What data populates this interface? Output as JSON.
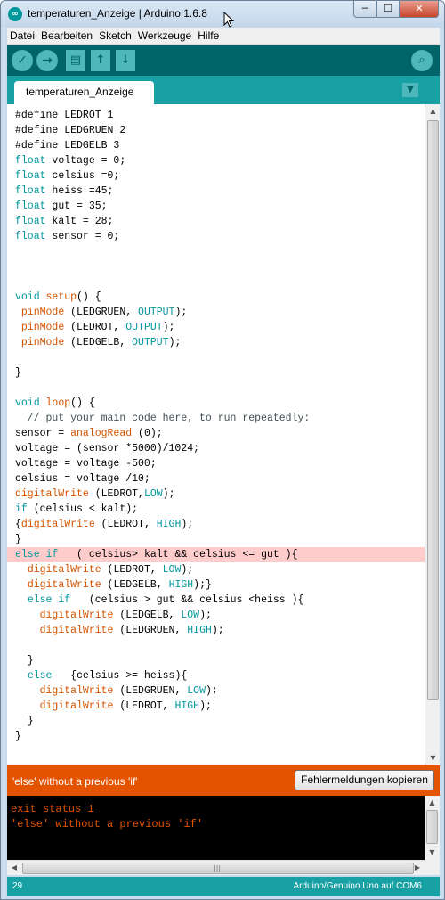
{
  "window": {
    "title": "temperaturen_Anzeige | Arduino 1.6.8",
    "app_icon": "arduino-logo-icon",
    "buttons": {
      "minimize": "─",
      "maximize": "☐",
      "close": "✕"
    }
  },
  "menu": {
    "items": [
      "Datei",
      "Bearbeiten",
      "Sketch",
      "Werkzeuge",
      "Hilfe"
    ]
  },
  "toolbar": {
    "verify_icon": "✓",
    "upload_icon": "→",
    "new_icon": "▤",
    "open_icon": "↑",
    "save_icon": "↓",
    "serial_monitor_icon": "⌕"
  },
  "tabs": {
    "active": "temperaturen_Anzeige",
    "menu_icon": "▼"
  },
  "editor": {
    "lines": [
      [
        {
          "t": "#define LEDROT 1",
          "c": ""
        }
      ],
      [
        {
          "t": "#define LEDGRUEN 2",
          "c": ""
        }
      ],
      [
        {
          "t": "#define LEDGELB 3",
          "c": ""
        }
      ],
      [
        {
          "t": "float",
          "c": "kw"
        },
        {
          "t": " voltage = 0;",
          "c": ""
        }
      ],
      [
        {
          "t": "float",
          "c": "kw"
        },
        {
          "t": " celsius =0;",
          "c": ""
        }
      ],
      [
        {
          "t": "float",
          "c": "kw"
        },
        {
          "t": " heiss =45;",
          "c": ""
        }
      ],
      [
        {
          "t": "float",
          "c": "kw"
        },
        {
          "t": " gut = 35;",
          "c": ""
        }
      ],
      [
        {
          "t": "float",
          "c": "kw"
        },
        {
          "t": " kalt = 28;",
          "c": ""
        }
      ],
      [
        {
          "t": "float",
          "c": "kw"
        },
        {
          "t": " sensor = 0;",
          "c": ""
        }
      ],
      [],
      [],
      [],
      [
        {
          "t": "void",
          "c": "kw"
        },
        {
          "t": " ",
          "c": ""
        },
        {
          "t": "setup",
          "c": "fn"
        },
        {
          "t": "() {",
          "c": ""
        }
      ],
      [
        {
          "t": " ",
          "c": ""
        },
        {
          "t": "pinMode",
          "c": "fn"
        },
        {
          "t": " (LEDGRUEN, ",
          "c": ""
        },
        {
          "t": "OUTPUT",
          "c": "ct"
        },
        {
          "t": ");",
          "c": ""
        }
      ],
      [
        {
          "t": " ",
          "c": ""
        },
        {
          "t": "pinMode",
          "c": "fn"
        },
        {
          "t": " (LEDROT, ",
          "c": ""
        },
        {
          "t": "OUTPUT",
          "c": "ct"
        },
        {
          "t": ");",
          "c": ""
        }
      ],
      [
        {
          "t": " ",
          "c": ""
        },
        {
          "t": "pinMode",
          "c": "fn"
        },
        {
          "t": " (LEDGELB, ",
          "c": ""
        },
        {
          "t": "OUTPUT",
          "c": "ct"
        },
        {
          "t": ");",
          "c": ""
        }
      ],
      [],
      [
        {
          "t": "}",
          "c": ""
        }
      ],
      [],
      [
        {
          "t": "void",
          "c": "kw"
        },
        {
          "t": " ",
          "c": ""
        },
        {
          "t": "loop",
          "c": "fn"
        },
        {
          "t": "() {",
          "c": ""
        }
      ],
      [
        {
          "t": "  // put your main code here, to run repeatedly:",
          "c": "cm"
        }
      ],
      [
        {
          "t": "sensor = ",
          "c": ""
        },
        {
          "t": "analogRead",
          "c": "fn"
        },
        {
          "t": " (0);",
          "c": ""
        }
      ],
      [
        {
          "t": "voltage = (sensor *5000)/1024;",
          "c": ""
        }
      ],
      [
        {
          "t": "voltage = voltage -500;",
          "c": ""
        }
      ],
      [
        {
          "t": "celsius = voltage /10;",
          "c": ""
        }
      ],
      [
        {
          "t": "digitalWrite",
          "c": "fn"
        },
        {
          "t": " (LEDROT,",
          "c": ""
        },
        {
          "t": "LOW",
          "c": "ct"
        },
        {
          "t": ");",
          "c": ""
        }
      ],
      [
        {
          "t": "if",
          "c": "kw"
        },
        {
          "t": " (celsius < kalt);",
          "c": ""
        }
      ],
      [
        {
          "t": "{",
          "c": ""
        },
        {
          "t": "digitalWrite",
          "c": "fn"
        },
        {
          "t": " (LEDROT, ",
          "c": ""
        },
        {
          "t": "HIGH",
          "c": "ct"
        },
        {
          "t": ");",
          "c": ""
        }
      ],
      [
        {
          "t": "}",
          "c": ""
        }
      ],
      [
        {
          "t": "else",
          "c": "kw"
        },
        {
          "t": " ",
          "c": ""
        },
        {
          "t": "if",
          "c": "kw"
        },
        {
          "t": "   ( celsius> kalt && celsius <= gut ){",
          "c": ""
        }
      ],
      [
        {
          "t": "  ",
          "c": ""
        },
        {
          "t": "digitalWrite",
          "c": "fn"
        },
        {
          "t": " (LEDROT, ",
          "c": ""
        },
        {
          "t": "LOW",
          "c": "ct"
        },
        {
          "t": ");",
          "c": ""
        }
      ],
      [
        {
          "t": "  ",
          "c": ""
        },
        {
          "t": "digitalWrite",
          "c": "fn"
        },
        {
          "t": " (LEDGELB, ",
          "c": ""
        },
        {
          "t": "HIGH",
          "c": "ct"
        },
        {
          "t": ");}",
          "c": ""
        }
      ],
      [
        {
          "t": "  ",
          "c": ""
        },
        {
          "t": "else",
          "c": "kw"
        },
        {
          "t": " ",
          "c": ""
        },
        {
          "t": "if",
          "c": "kw"
        },
        {
          "t": "   (celsius > gut && celsius <heiss ){",
          "c": ""
        }
      ],
      [
        {
          "t": "    ",
          "c": ""
        },
        {
          "t": "digitalWrite",
          "c": "fn"
        },
        {
          "t": " (LEDGELB, ",
          "c": ""
        },
        {
          "t": "LOW",
          "c": "ct"
        },
        {
          "t": ");",
          "c": ""
        }
      ],
      [
        {
          "t": "    ",
          "c": ""
        },
        {
          "t": "digitalWrite",
          "c": "fn"
        },
        {
          "t": " (LEDGRUEN, ",
          "c": ""
        },
        {
          "t": "HIGH",
          "c": "ct"
        },
        {
          "t": ");",
          "c": ""
        }
      ],
      [],
      [
        {
          "t": "  }",
          "c": ""
        }
      ],
      [
        {
          "t": "  ",
          "c": ""
        },
        {
          "t": "else",
          "c": "kw"
        },
        {
          "t": "   {celsius >= heiss){",
          "c": ""
        }
      ],
      [
        {
          "t": "    ",
          "c": ""
        },
        {
          "t": "digitalWrite",
          "c": "fn"
        },
        {
          "t": " (LEDGRUEN, ",
          "c": ""
        },
        {
          "t": "LOW",
          "c": "ct"
        },
        {
          "t": ");",
          "c": ""
        }
      ],
      [
        {
          "t": "    ",
          "c": ""
        },
        {
          "t": "digitalWrite",
          "c": "fn"
        },
        {
          "t": " (LEDROT, ",
          "c": ""
        },
        {
          "t": "HIGH",
          "c": "ct"
        },
        {
          "t": ");",
          "c": ""
        }
      ],
      [
        {
          "t": "  }",
          "c": ""
        }
      ],
      [
        {
          "t": "}",
          "c": ""
        }
      ]
    ],
    "error_line_number": 30
  },
  "error_bar": {
    "message": "'else' without a previous 'if'",
    "copy_button": "Fehlermeldungen kopieren"
  },
  "console": {
    "lines": [
      "exit status 1",
      "'else' without a previous 'if'"
    ]
  },
  "scrollbars": {
    "up_arrow": "▲",
    "down_arrow": "▼",
    "left_arrow": "◀",
    "right_arrow": "▶",
    "grip": "|||"
  },
  "status": {
    "line": "29",
    "board": "Arduino/Genuino Uno auf COM6"
  },
  "colors": {
    "toolbar": "#006468",
    "tab_strip": "#17a1a5",
    "error_bar": "#e35300",
    "error_line_highlight": "#ffcccc",
    "keyword": "#00979c",
    "function": "#d35400"
  }
}
